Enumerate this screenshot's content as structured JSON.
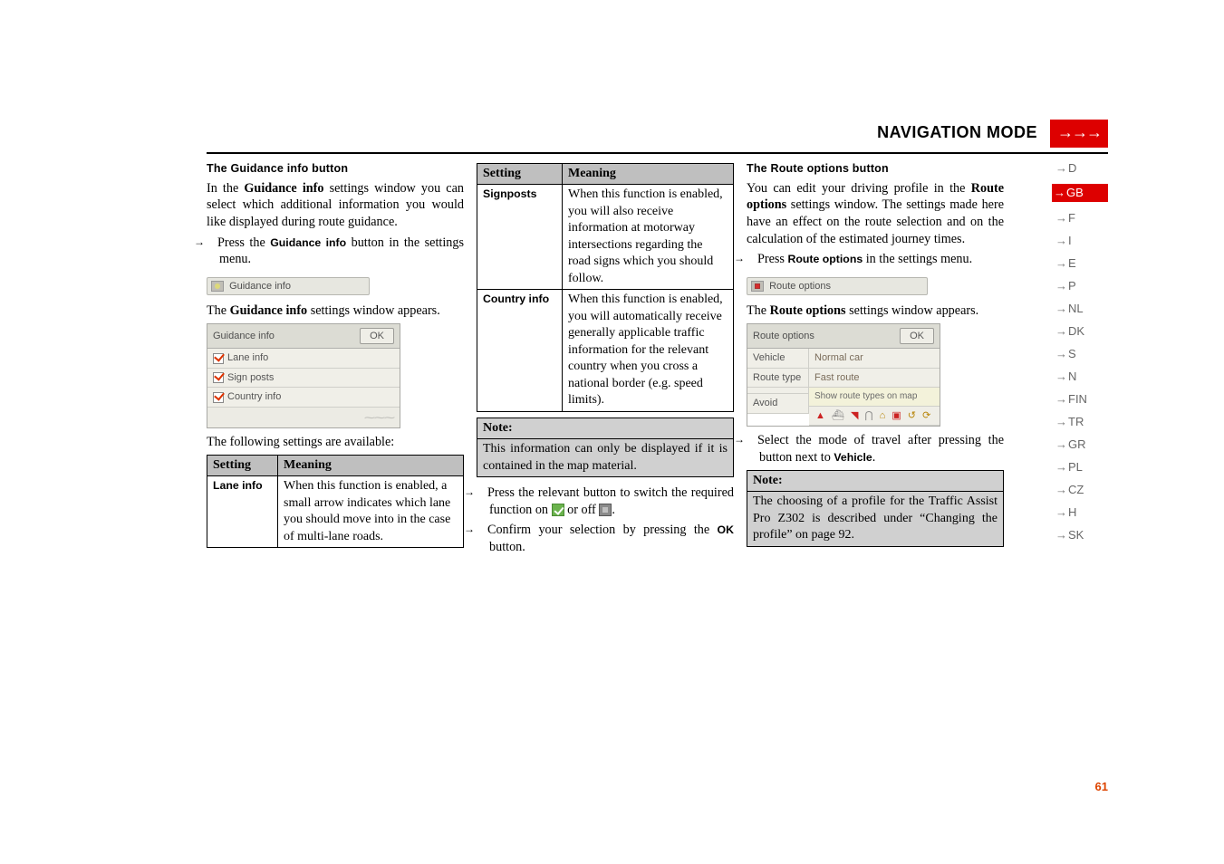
{
  "header": {
    "title": "NAVIGATION MODE",
    "arrows": "→→→"
  },
  "page_number": "61",
  "sidenav": [
    {
      "code": "D",
      "active": false
    },
    {
      "code": "GB",
      "active": true
    },
    {
      "code": "F",
      "active": false
    },
    {
      "code": "I",
      "active": false
    },
    {
      "code": "E",
      "active": false
    },
    {
      "code": "P",
      "active": false
    },
    {
      "code": "NL",
      "active": false
    },
    {
      "code": "DK",
      "active": false
    },
    {
      "code": "S",
      "active": false
    },
    {
      "code": "N",
      "active": false
    },
    {
      "code": "FIN",
      "active": false
    },
    {
      "code": "TR",
      "active": false
    },
    {
      "code": "GR",
      "active": false
    },
    {
      "code": "PL",
      "active": false
    },
    {
      "code": "CZ",
      "active": false
    },
    {
      "code": "H",
      "active": false
    },
    {
      "code": "SK",
      "active": false
    }
  ],
  "col1": {
    "heading": "The Guidance info button",
    "p1a": "In the ",
    "p1b": "Guidance info",
    "p1c": " settings window you can select which additional information you would like displayed during route guidance.",
    "press_a": "Press the ",
    "press_b": "Guidance info",
    "press_c": " button in the settings menu.",
    "tab": "Guidance info",
    "after_tab_a": "The ",
    "after_tab_b": "Guidance info",
    "after_tab_c": " settings window appears.",
    "panel": {
      "title": "Guidance info",
      "ok": "OK",
      "rows": [
        "Lane info",
        "Sign posts",
        "Country info"
      ]
    },
    "after_panel": "The following settings are available:",
    "table": {
      "h1": "Setting",
      "h2": "Meaning",
      "r1c1": "Lane info",
      "r1c2": "When this function is enabled, a small arrow indicates which lane you should move into in the case of multi-lane roads."
    }
  },
  "col2": {
    "table": {
      "h1": "Setting",
      "h2": "Meaning",
      "rows": [
        {
          "c1": "Signposts",
          "c2": "When this function is enabled, you will also receive information at motorway intersections regarding the road signs which you should follow."
        },
        {
          "c1": "Country info",
          "c2": "When this function is enabled, you will automatically receive generally applicable traffic information for the relevant country when you cross a national border (e.g. speed limits)."
        }
      ]
    },
    "note": {
      "title": "Note:",
      "body": "This information can only be displayed if it is contained in the map material."
    },
    "step1": "Press the relevant button to switch the required function on ",
    "step1_mid": " or off ",
    "step1_end": ".",
    "step2a": "Confirm your selection by pressing the ",
    "step2b": "OK",
    "step2c": " button."
  },
  "col3": {
    "heading": "The Route options button",
    "p1_a": "You can edit your driving profile in the ",
    "p1_b": "Route options",
    "p1_c": " settings window. The settings made here have an effect on the route selection and on the calculation of the estimated journey times.",
    "press_a": "Press ",
    "press_b": "Route options",
    "press_c": " in the settings menu.",
    "tab": "Route options",
    "after_tab_a": "The ",
    "after_tab_b": "Route options",
    "after_tab_c": " settings window appears.",
    "panel": {
      "title": "Route options",
      "ok": "OK",
      "left": [
        "Vehicle",
        "Route type",
        "",
        "Avoid"
      ],
      "right": [
        "Normal car",
        "Fast route",
        "Show route types on map"
      ]
    },
    "sel_a": "Select the mode of travel after pressing the button next to ",
    "sel_b": "Vehicle",
    "sel_c": ".",
    "note": {
      "title": "Note:",
      "body": "The choosing of a profile for the Traffic Assist Pro Z302 is described under “Changing the profile” on page 92."
    }
  }
}
